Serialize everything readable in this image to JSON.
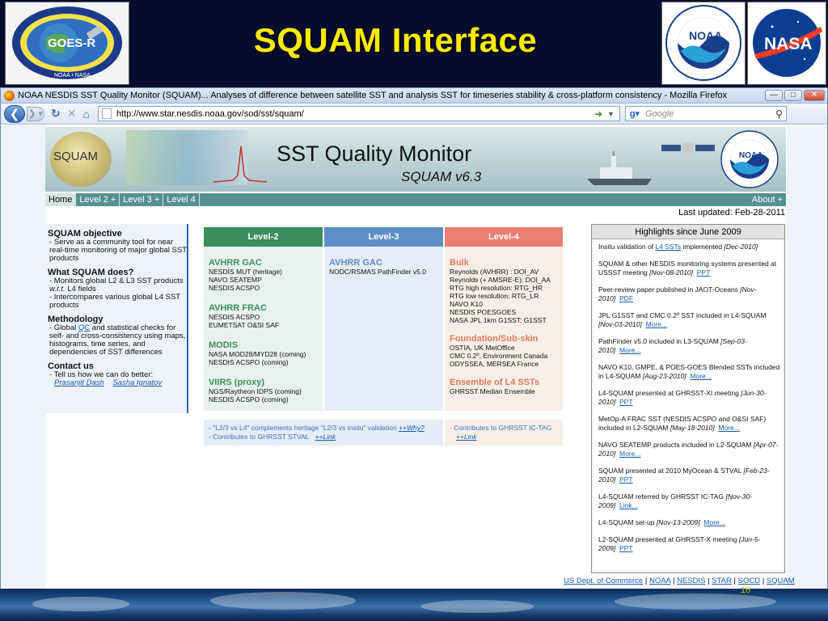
{
  "slide": {
    "title": "SQUAM Interface",
    "page_number": "16",
    "logos": {
      "goes": "GOES-R",
      "goes_bottom": "NOAA • NASA",
      "noaa": "NOAA",
      "nasa": "NASA"
    }
  },
  "browser": {
    "window_title": "NOAA NESDIS SST Quality Monitor (SQUAM)... Analyses of difference between satellite SST and analysis SST for timeseries stability & cross-platform consistency - Mozilla Firefox",
    "url": "http://www.star.nesdis.noaa.gov/sod/sst/squam/",
    "search_placeholder": "Google",
    "window_buttons": {
      "minimize": "—",
      "maximize": "□",
      "close": "✕"
    }
  },
  "banner": {
    "logo_text": "SQUAM",
    "title": "SST Quality Monitor",
    "subtitle": "SQUAM v6.3",
    "noaa_logo": "NOAA"
  },
  "tabs": [
    "Home",
    "Level 2 +",
    "Level 3 +",
    "Level 4"
  ],
  "about": "About +",
  "last_updated": "Last updated: Feb-28-2011",
  "sidebar": {
    "objective_title": "SQUAM objective",
    "objective_text": "- Serve as a community tool for near real-time monitoring of major global SST products",
    "does_title": "What SQUAM does?",
    "does_item1_a": "- Monitors global L2 & L3 SST products ",
    "does_item1_em": "w.r.t.",
    "does_item1_b": " L4 fields",
    "does_item2": "- Intercompares various global L4 SST products",
    "method_title": "Methodology",
    "method_a": "- Global ",
    "method_link": "QC",
    "method_b": " and statistical checks for self- and cross-consistency using maps, histograms, time series, and dependencies of SST differences",
    "contact_title": "Contact us",
    "contact_text": "- Tell us how we can do better:",
    "contact_name1": "Prasanjit Dash",
    "contact_name2": "Sasha Ignatov"
  },
  "levels": {
    "l2": {
      "header": "Level-2",
      "groups": [
        {
          "title": "AVHRR GAC",
          "items": [
            "NESDIS MUT (heritage)",
            "NAVO SEATEMP",
            "NESDIS ACSPO"
          ]
        },
        {
          "title": "AVHRR FRAC",
          "items": [
            "NESDIS ACSPO",
            "EUMETSAT O&SI SAF"
          ]
        },
        {
          "title": "MODIS",
          "items": [
            "NASA MOD28/MYD28 (coming)",
            "NESDIS ACSPO (coming)"
          ]
        },
        {
          "title": "VIIRS (proxy)",
          "items": [
            "NGS/Raytheon IDPS (coming)",
            "NESDIS ACSPO (coming)"
          ]
        }
      ]
    },
    "l3": {
      "header": "Level-3",
      "groups": [
        {
          "title": "AVHRR GAC",
          "items": [
            "NODC/RSMAS PathFinder v5.0"
          ]
        }
      ]
    },
    "l4": {
      "header": "Level-4",
      "groups": [
        {
          "title": "Bulk",
          "items": [
            "Reynolds (AVHRR) : DOI_AV",
            "Reynolds (+ AMSRE-E): DOI_AA",
            "RTG high resolution: RTG_HR",
            "RTG low resolution: RTG_LR",
            "NAVO K10",
            "NESDIS POESGOES",
            "NASA JPL 1km G1SST: G1SST"
          ]
        },
        {
          "title": "Foundation/Sub-skin",
          "items": [
            "OSTIA, UK MetOffice",
            "CMC 0.2º, Environment Canada",
            "ODYSSEA, MERSEA France"
          ]
        },
        {
          "title": "Ensemble of L4 SSTs",
          "items": [
            "GHRSST Median Ensemble"
          ]
        }
      ]
    },
    "notes_l23": {
      "line1": "- \"L2/3 vs L4\" complements heritage \"L2/3 vs insitu\" validation ",
      "line1_link": "++Why?",
      "line2": "- Contributes to GHRSST STVAL",
      "line2_link": "++Link"
    },
    "notes_l4": {
      "line1": "- Contributes to GHRSST IC-TAG",
      "line1_link": "++Link"
    }
  },
  "highlights": {
    "title": "Highlights since June 2009",
    "items": [
      {
        "pre": "Insitu validation of ",
        "link_mid": "L4 SSTs",
        "text": " implemented ",
        "date": "[Dec-2010]",
        "link": ""
      },
      {
        "text": "SQUAM & other NESDIS monitoring systems presented at USSST meeting ",
        "date": "[Nov-08-2010]",
        "link": "PPT"
      },
      {
        "text": "Peer-review paper published in JAOT-Oceans ",
        "date": "[Nov-2010]",
        "link": "PDF"
      },
      {
        "text": "JPL G1SST and CMC 0.2º SST included in L4-SQUAM ",
        "date": "[Nov-03-2010]",
        "link": "More..."
      },
      {
        "text": "PathFinder v5.0 included in L3-SQUAM ",
        "date": "[Sep-03-2010]",
        "link": "More..."
      },
      {
        "text": "NAVO K10, GMPE, & POES-GOES Blended SSTs included in L4-SQUAM ",
        "date": "[Aug-23-2010]",
        "link": "More..."
      },
      {
        "text": "L4-SQUAM presented at GHRSST-XI meeting ",
        "date": "[Jun-30-2010]",
        "link": "PPT"
      },
      {
        "text": "MetOp-A FRAC SST (NESDIS ACSPO and O&SI SAF) included in L2-SQUAM ",
        "date": "[May-18-2010]",
        "link": "More..."
      },
      {
        "text": "NAVO SEATEMP products included in L2-SQUAM ",
        "date": "[Apr-07-2010]",
        "link": "More..."
      },
      {
        "text": "SQUAM presented at 2010 MyOcean & STVAL ",
        "date": "[Feb-23-2010]",
        "link": "PPT"
      },
      {
        "text": "L4-SQUAM referred by GHRSST IC-TAG ",
        "date": "[Nov-30-2009]",
        "link": "Link..."
      },
      {
        "text": "L4-SQUAM set-up ",
        "date": "[Nov-13-2009]",
        "link": "More..."
      },
      {
        "text": "L2-SQUAM presented at GHRSST-X meeting ",
        "date": "[Jun-5-2009]",
        "link": "PPT"
      }
    ]
  },
  "footer_links": [
    "US Dept. of Commerce",
    "NOAA",
    "NESDIS",
    "STAR",
    "SOCD",
    "SQUAM"
  ],
  "colors": {
    "slide_title": "#ffeb00",
    "slide_bg": "#070c2e",
    "level2": "#3b8e5b",
    "level3": "#5e8ec8",
    "level4": "#eb7e70",
    "tabbar": "#58908f",
    "link": "#1a59b8"
  },
  "icons": {
    "back": "back-arrow-icon",
    "forward": "forward-arrow-icon",
    "reload": "reload-icon",
    "stop": "stop-icon",
    "home": "home-icon",
    "search": "magnifier-icon"
  }
}
